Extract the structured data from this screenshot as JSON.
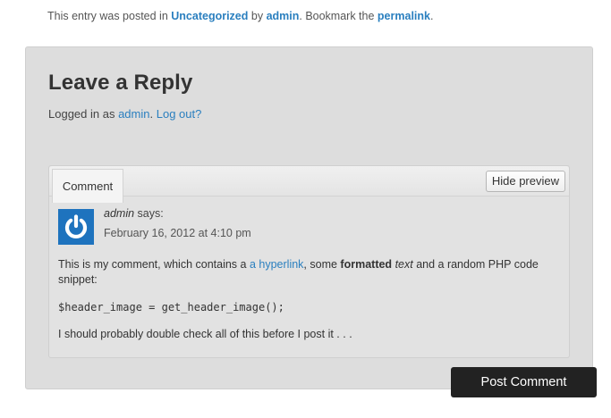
{
  "entry_meta": {
    "prefix": "This entry was posted in ",
    "category": "Uncategorized",
    "by": " by ",
    "author": "admin",
    "bookmark": ". Bookmark the ",
    "permalink": "permalink",
    "end": "."
  },
  "reply": {
    "title": "Leave a Reply",
    "logged_in_prefix": "Logged in as ",
    "user": "admin",
    "sep": ". ",
    "logout": "Log out?"
  },
  "preview": {
    "tab_label": "Comment",
    "hide_button": "Hide preview",
    "author": "admin",
    "says": " says:",
    "date": "February 16, 2012 at 4:10 pm",
    "body": {
      "p1_a": "This is my comment, which contains a ",
      "p1_link": "a hyperlink",
      "p1_b": ", some ",
      "p1_bold": "formatted",
      "p1_c": " ",
      "p1_italic": "text",
      "p1_d": " and a random PHP code snippet:",
      "code": "$header_image = get_header_image();",
      "p3": "I should probably double check all of this before I post it . . ."
    }
  },
  "submit": {
    "label": "Post Comment"
  },
  "colors": {
    "link": "#2a7fbf",
    "avatar": "#1e73be",
    "button": "#222222",
    "panel": "#dddddd"
  },
  "icons": {
    "avatar": "power-icon"
  }
}
